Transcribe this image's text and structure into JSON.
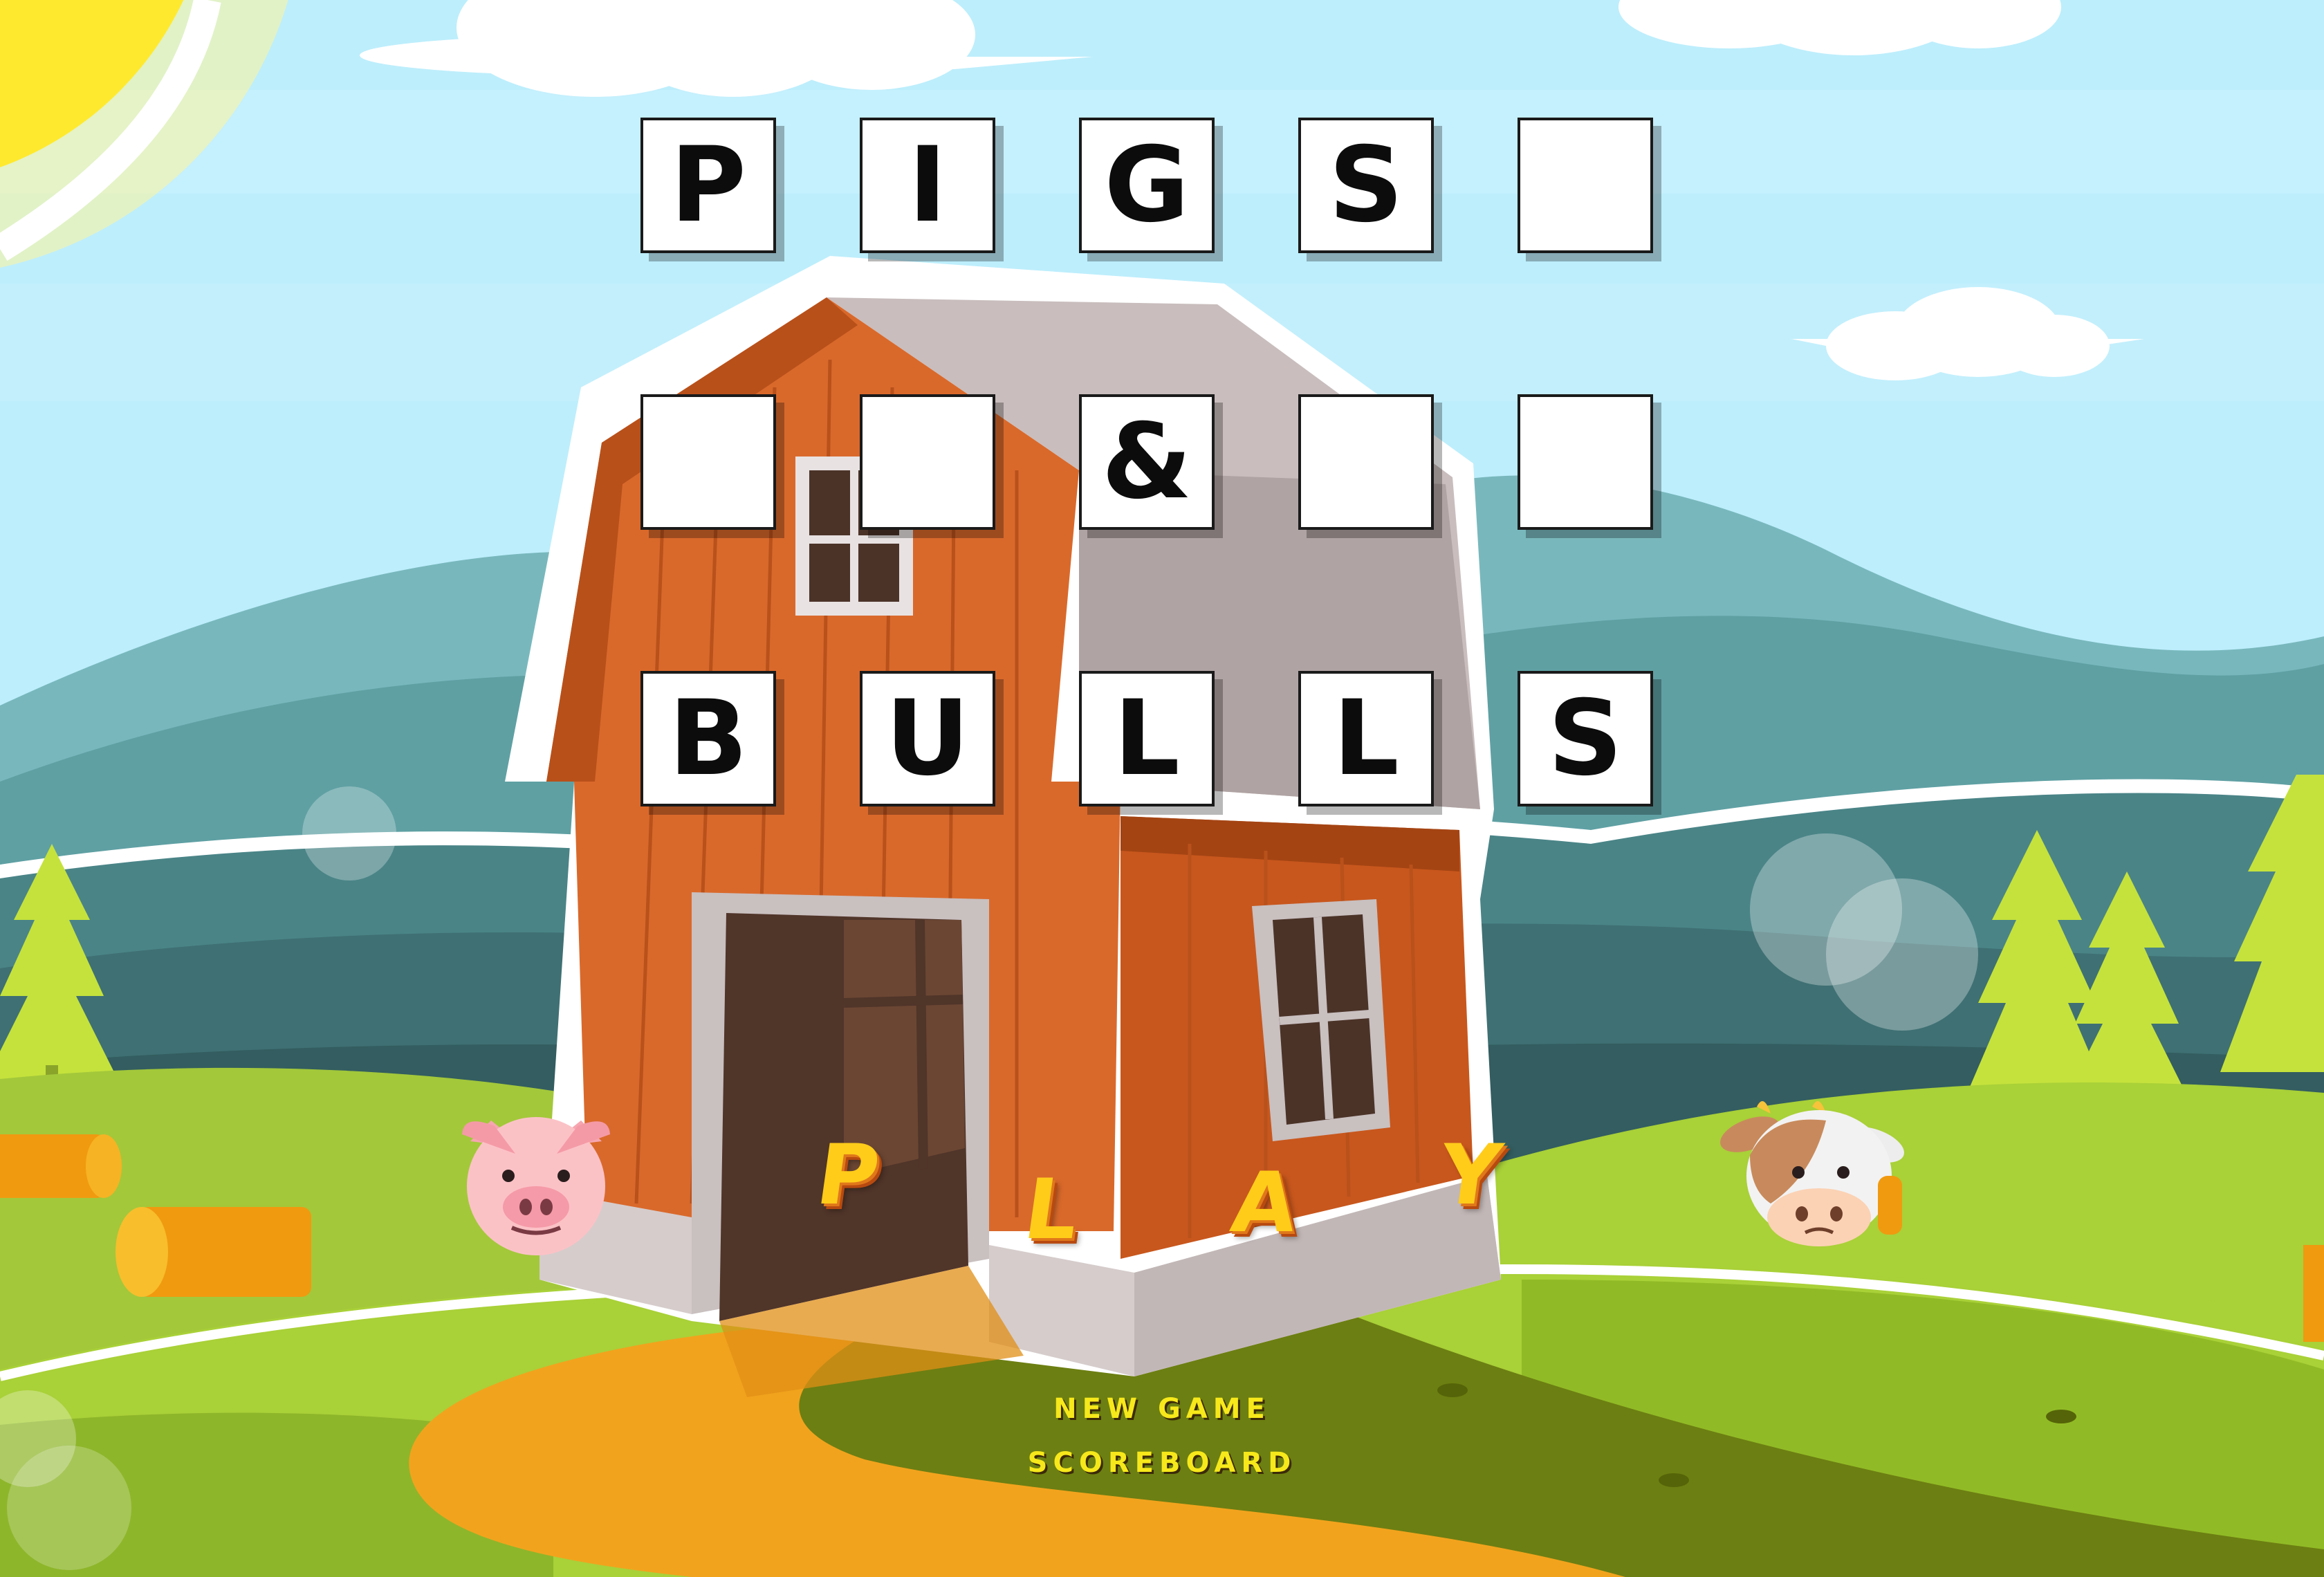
{
  "title": {
    "row1": [
      "P",
      "I",
      "G",
      "S",
      ""
    ],
    "row2": [
      "",
      "",
      "&",
      "",
      ""
    ],
    "row3": [
      "B",
      "U",
      "L",
      "L",
      "S"
    ]
  },
  "play": [
    "P",
    "L",
    "A",
    "Y"
  ],
  "menu": {
    "new_game": "NEW GAME",
    "scoreboard": "SCOREBOARD"
  },
  "colors": {
    "sky": "#bdeefc",
    "barn": "#d9692b",
    "roof": "#c9bdbd",
    "grass": "#a9d138",
    "path": "#f2a31d",
    "menu_text": "#f7e81b",
    "play_text": "#ffcc1a"
  },
  "icons": [
    "pig-icon",
    "cow-icon",
    "sun-icon",
    "cloud-icon",
    "pine-tree-icon",
    "hay-bale-icon"
  ]
}
